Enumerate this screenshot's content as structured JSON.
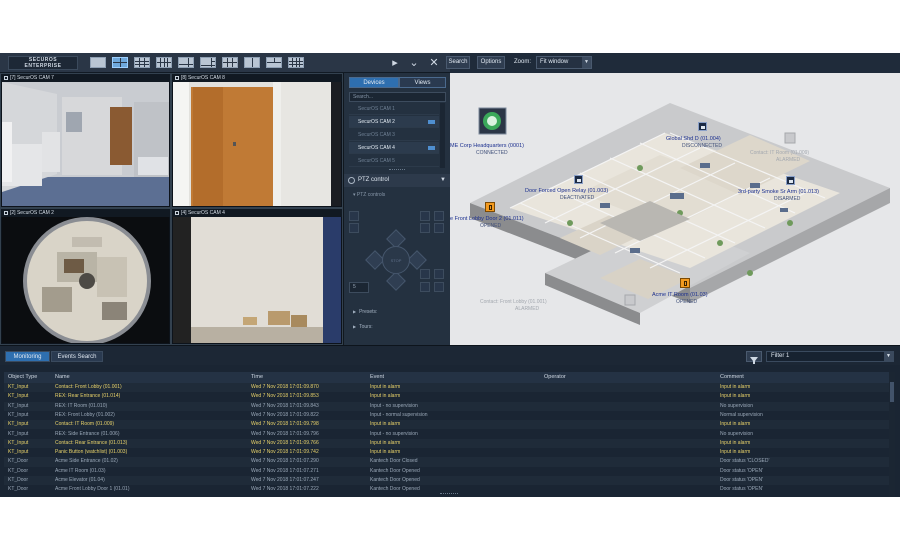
{
  "brand": {
    "line1": "SECUROS",
    "line2": "ENTERPRISE"
  },
  "toolbar": {
    "search_label": "Search",
    "options_label": "Options",
    "zoom_label": "Zoom:",
    "zoom_value": "Fit window"
  },
  "cameras": [
    {
      "title": "[7] SecurOS CAM 7"
    },
    {
      "title": "[8] SecurOS CAM 8"
    },
    {
      "title": "[2] SecurOS CAM 2"
    },
    {
      "title": "[4] SecurOS CAM 4"
    }
  ],
  "side_panel": {
    "tabs": [
      "Devices",
      "Views"
    ],
    "search_placeholder": "Search...",
    "devices": [
      {
        "label": "SecurOS CAM 1",
        "active": false
      },
      {
        "label": "SecurOS CAM 2",
        "active": true
      },
      {
        "label": "SecurOS CAM 3",
        "active": false
      },
      {
        "label": "SecurOS CAM 4",
        "active": true
      },
      {
        "label": "SecurOS CAM 5",
        "active": false
      }
    ],
    "ptz_header": "PTZ control",
    "ptz_controls_label": "PTZ controls",
    "ptz_center_label": "STOP",
    "ptz_speed": "5",
    "presets_label": "Presets:",
    "tours_label": "Tours:"
  },
  "map": {
    "labels": [
      {
        "name": "ME Corp Headquarters (0001)",
        "status": "CONNECTED"
      },
      {
        "name": "Global Shd D (01.004)",
        "status": "DISCONNECTED"
      },
      {
        "name": "Door Forced Open Relay (01.003)",
        "status": "DEACTIVATED"
      },
      {
        "name": "3rd-party Smoke Sr Arm (01.013)",
        "status": "DISARMED"
      },
      {
        "name": "e Front Lobby Door 2 (01.011)",
        "status": "OPENED"
      },
      {
        "name": "Acme IT Room (01.03)",
        "status": "OPENED"
      }
    ],
    "ghost_labels": [
      "Contact: IT Room (01.009)",
      "Contact: Front Lobby (01.001)"
    ],
    "ghost_status": [
      "ALARMED",
      "ALARMED"
    ]
  },
  "bottom": {
    "tabs": [
      "Monitoring",
      "Events Search"
    ],
    "filter_value": "Filter 1",
    "columns": [
      "Object Type",
      "Name",
      "Time",
      "Event",
      "Operator",
      "Comment"
    ],
    "rows": [
      {
        "type": "KT_Input",
        "name": "Contact: Front Lobby (01.001)",
        "time": "Wed 7 Nov 2018 17:01:09.870",
        "event": "Input in alarm",
        "operator": "",
        "comment": "Input in alarm",
        "level": "alarm"
      },
      {
        "type": "KT_Input",
        "name": "REX: Rear Entrance (01.014)",
        "time": "Wed 7 Nov 2018 17:01:09.853",
        "event": "Input in alarm",
        "operator": "",
        "comment": "Input in alarm",
        "level": "alarm"
      },
      {
        "type": "KT_Input",
        "name": "REX: IT Room (01.010)",
        "time": "Wed 7 Nov 2018 17:01:09.843",
        "event": "Input - no supervision",
        "operator": "",
        "comment": "No supervision",
        "level": "normal"
      },
      {
        "type": "KT_Input",
        "name": "REX: Front Lobby (01.002)",
        "time": "Wed 7 Nov 2018 17:01:09.822",
        "event": "Input - normal supervision",
        "operator": "",
        "comment": "Normal supervision",
        "level": "normal"
      },
      {
        "type": "KT_Input",
        "name": "Contact: IT Room (01.009)",
        "time": "Wed 7 Nov 2018 17:01:09.798",
        "event": "Input in alarm",
        "operator": "",
        "comment": "Input in alarm",
        "level": "alarm"
      },
      {
        "type": "KT_Input",
        "name": "REX: Side Entrance (01.006)",
        "time": "Wed 7 Nov 2018 17:01:09.796",
        "event": "Input - no supervision",
        "operator": "",
        "comment": "No supervision",
        "level": "normal"
      },
      {
        "type": "KT_Input",
        "name": "Contact: Rear Entrance (01.013)",
        "time": "Wed 7 Nov 2018 17:01:09.766",
        "event": "Input in alarm",
        "operator": "",
        "comment": "Input in alarm",
        "level": "alarm"
      },
      {
        "type": "KT_Input",
        "name": "Panic Button (watchlist) (01.003)",
        "time": "Wed 7 Nov 2018 17:01:09.742",
        "event": "Input in alarm",
        "operator": "",
        "comment": "Input in alarm",
        "level": "alarm"
      },
      {
        "type": "KT_Door",
        "name": "Acme Side Entrance (01.02)",
        "time": "Wed 7 Nov 2018 17:01:07.290",
        "event": "Kantech Door Closed",
        "operator": "",
        "comment": "Door status 'CLOSED'",
        "level": "normal"
      },
      {
        "type": "KT_Door",
        "name": "Acme IT Room (01.03)",
        "time": "Wed 7 Nov 2018 17:01:07.271",
        "event": "Kantech Door Opened",
        "operator": "",
        "comment": "Door status 'OPEN'",
        "level": "normal"
      },
      {
        "type": "KT_Door",
        "name": "Acme Elevator (01.04)",
        "time": "Wed 7 Nov 2018 17:01:07.247",
        "event": "Kantech Door Opened",
        "operator": "",
        "comment": "Door status 'OPEN'",
        "level": "normal"
      },
      {
        "type": "KT_Door",
        "name": "Acme Front Lobby Door 1 (01.01)",
        "time": "Wed 7 Nov 2018 17:01:07.222",
        "event": "Kantech Door Opened",
        "operator": "",
        "comment": "Door status 'OPEN'",
        "level": "normal"
      }
    ]
  },
  "colors": {
    "alarm_text": "#e8d26a",
    "normal_text": "#9aa8b8",
    "accent": "#2e6fb0",
    "panel": "#1a2533"
  }
}
